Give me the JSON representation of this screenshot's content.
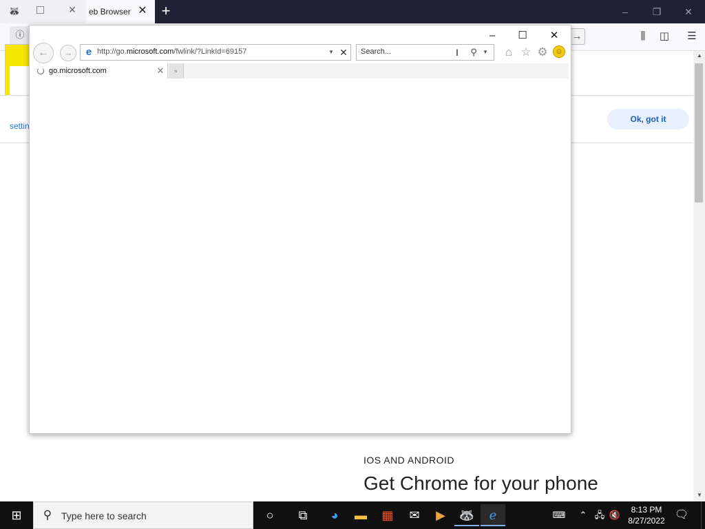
{
  "firefox": {
    "tab_title": "eb Browser",
    "notice": {
      "settings_link": "settin",
      "ok_button": "Ok, got it"
    },
    "page": {
      "section_label": "IOS AND ANDROID",
      "heading": "Get Chrome for your phone"
    }
  },
  "ie": {
    "address": {
      "prefix": "http://go.",
      "host": "microsoft.com",
      "path": "/fwlink/?LinkId=69157"
    },
    "search": {
      "placeholder": "Search..."
    },
    "tab": {
      "title": "go.microsoft.com"
    }
  },
  "taskbar": {
    "search_placeholder": "Type here to search",
    "clock": {
      "time": "8:13 PM",
      "date": "8/27/2022"
    }
  },
  "colors": {
    "firefox_titlebar": "#1f2235",
    "taskbar": "#101010",
    "ok_button_bg": "#e8f0fe",
    "link": "#1a73e8",
    "ie_logo": "#1e73c8"
  }
}
